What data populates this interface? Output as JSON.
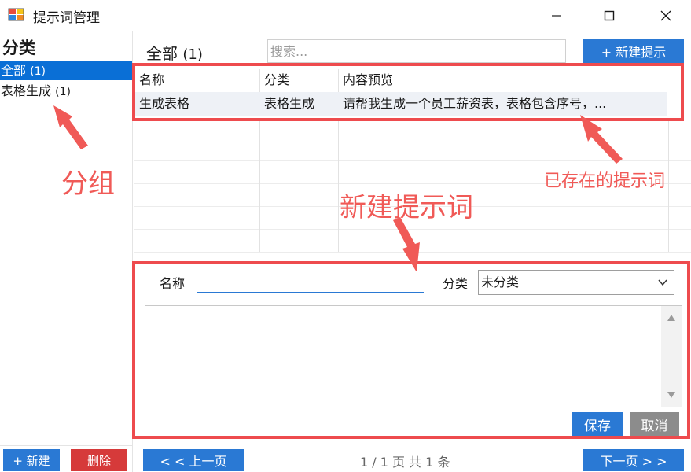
{
  "window": {
    "title": "提示词管理"
  },
  "sidebar": {
    "heading": "分类",
    "items": [
      {
        "label": "全部",
        "count": "(1)"
      },
      {
        "label": "表格生成",
        "count": "(1)"
      }
    ],
    "new_label": "+ 新建",
    "delete_label": "删除"
  },
  "main": {
    "title": "全部",
    "title_count": "(1)",
    "search_placeholder": "搜索...",
    "new_prompt_label": "+ 新建提示"
  },
  "table": {
    "columns": [
      "名称",
      "分类",
      "内容预览"
    ],
    "rows": [
      {
        "name": "生成表格",
        "category": "表格生成",
        "preview": "请帮我生成一个员工薪资表，表格包含序号，..."
      }
    ]
  },
  "form": {
    "name_label": "名称",
    "name_value": "",
    "category_label": "分类",
    "category_value": "未分类",
    "content_value": "",
    "save_label": "保存",
    "cancel_label": "取消"
  },
  "pager": {
    "prev_label": "< < 上一页",
    "info": "1 / 1 页  共 1 条",
    "next_label": "下一页 > >"
  },
  "annotations": {
    "group": "分组",
    "existing": "已存在的提示词",
    "new_prompt": "新建提示词"
  },
  "colors": {
    "accent": "#2a79d4",
    "selected": "#0a6fd6",
    "danger": "#d63a3a",
    "annotation": "#ee4b4e",
    "neutral_button": "#8c8c8c"
  }
}
